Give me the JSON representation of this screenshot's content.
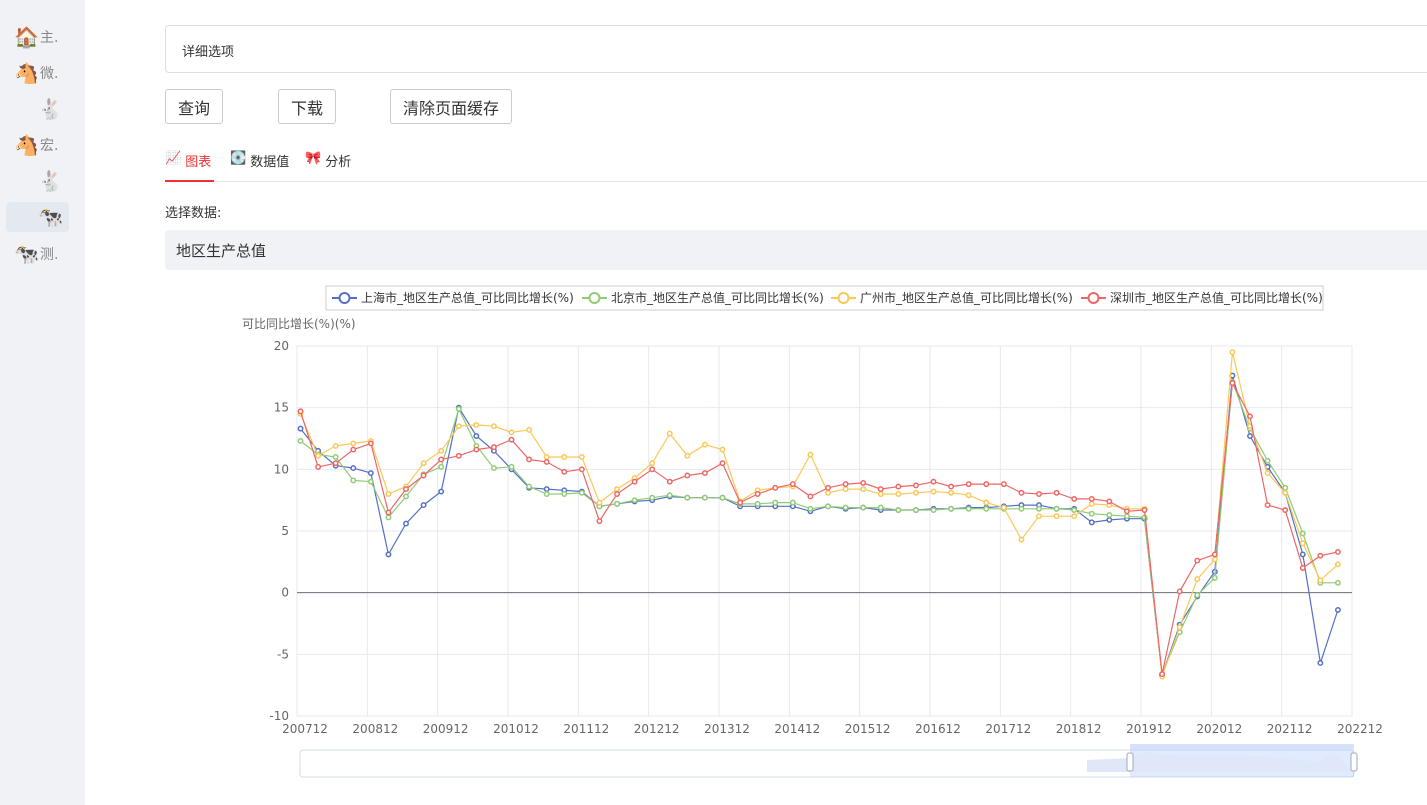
{
  "sidebar": {
    "items": [
      {
        "icon": "house-icon",
        "glyph": "🏠",
        "label": "主."
      },
      {
        "icon": "horse-icon",
        "glyph": "🐴",
        "label": "微."
      },
      {
        "icon": "rabbit-icon",
        "glyph": "🐇",
        "label": ""
      },
      {
        "icon": "horse-icon",
        "glyph": "🐴",
        "label": "宏."
      },
      {
        "icon": "rabbit-icon",
        "glyph": "🐇",
        "label": ""
      },
      {
        "icon": "cow-icon",
        "glyph": "🐄",
        "label": "",
        "active": true
      },
      {
        "icon": "cow-icon",
        "glyph": "🐄",
        "label": "测."
      }
    ]
  },
  "detail": {
    "placeholder": "详细选项"
  },
  "buttons": {
    "query": "查询",
    "download": "下载",
    "clear_cache": "清除页面缓存"
  },
  "tabs": [
    {
      "icon": "chart-icon",
      "glyph": "📈",
      "label": "图表",
      "active": true
    },
    {
      "icon": "disk-icon",
      "glyph": "💽",
      "label": "数据值"
    },
    {
      "icon": "ribbon-icon",
      "glyph": "🎀",
      "label": "分析"
    }
  ],
  "select_label": "选择数据:",
  "select_value": "地区生产总值",
  "chart_data": {
    "type": "line",
    "ylabel": "可比同比增长(%)(%)",
    "ylim": [
      -10,
      20
    ],
    "yticks": [
      "20",
      "15",
      "10",
      "5",
      "0",
      "-5",
      "-10"
    ],
    "xticks": [
      "200712",
      "200812",
      "200912",
      "201012",
      "201112",
      "201212",
      "201312",
      "201412",
      "201512",
      "201612",
      "201712",
      "201812",
      "201912",
      "202012",
      "202112",
      "202212"
    ],
    "legend_position": "top",
    "grid": true,
    "start_quarter": "2007Q4",
    "quarter_step": 1,
    "series": [
      {
        "name": "上海市_地区生产总值_可比同比增长(%)",
        "color": "#5470c6",
        "values": [
          13.3,
          11.5,
          10.3,
          10.1,
          9.7,
          3.1,
          5.6,
          7.1,
          8.2,
          15.0,
          12.7,
          11.5,
          10.0,
          8.5,
          8.4,
          8.3,
          8.2,
          7.0,
          7.2,
          7.4,
          7.5,
          7.8,
          7.7,
          7.7,
          7.7,
          7.0,
          7.0,
          7.0,
          7.0,
          6.6,
          7.0,
          6.8,
          6.9,
          6.7,
          6.7,
          6.7,
          6.8,
          6.8,
          6.9,
          6.9,
          7.0,
          7.1,
          7.1,
          6.8,
          6.8,
          5.7,
          5.9,
          6.0,
          6.0,
          -6.7,
          -2.6,
          -0.3,
          1.7,
          17.6,
          12.7,
          10.2,
          8.1,
          3.1,
          -5.7,
          -1.4
        ]
      },
      {
        "name": "北京市_地区生产总值_可比同比增长(%)",
        "color": "#91cc75",
        "values": [
          12.3,
          11.2,
          11.0,
          9.1,
          9.0,
          6.1,
          7.8,
          9.6,
          10.2,
          14.9,
          11.9,
          10.1,
          10.2,
          8.6,
          8.0,
          8.0,
          8.1,
          7.0,
          7.2,
          7.5,
          7.7,
          7.9,
          7.7,
          7.7,
          7.7,
          7.2,
          7.2,
          7.3,
          7.3,
          6.8,
          7.0,
          6.9,
          6.9,
          6.9,
          6.7,
          6.7,
          6.7,
          6.8,
          6.8,
          6.8,
          6.8,
          6.8,
          6.8,
          6.8,
          6.7,
          6.4,
          6.3,
          6.2,
          6.1,
          -6.6,
          -3.2,
          -0.2,
          1.2,
          17.1,
          13.3,
          10.7,
          8.5,
          4.8,
          0.8,
          0.8
        ]
      },
      {
        "name": "广州市_地区生产总值_可比同比增长(%)",
        "color": "#fac858",
        "values": [
          14.5,
          11.1,
          11.9,
          12.1,
          12.3,
          8.0,
          8.6,
          10.5,
          11.5,
          13.5,
          13.6,
          13.5,
          13.0,
          13.2,
          11.0,
          11.0,
          11.0,
          7.3,
          8.4,
          9.3,
          10.5,
          12.9,
          11.1,
          12.0,
          11.6,
          7.4,
          8.3,
          8.5,
          8.6,
          11.2,
          8.1,
          8.4,
          8.4,
          8.0,
          8.0,
          8.1,
          8.2,
          8.1,
          7.9,
          7.3,
          6.9,
          4.3,
          6.2,
          6.2,
          6.2,
          7.2,
          7.1,
          6.8,
          6.8,
          -6.8,
          -2.8,
          1.1,
          2.7,
          19.5,
          13.5,
          9.7,
          8.1,
          4.0,
          1.0,
          2.3
        ]
      },
      {
        "name": "深圳市_地区生产总值_可比同比增长(%)",
        "color": "#ee6666",
        "values": [
          14.7,
          10.2,
          10.5,
          11.6,
          12.1,
          6.5,
          8.4,
          9.5,
          10.8,
          11.1,
          11.6,
          11.8,
          12.4,
          10.8,
          10.6,
          9.8,
          10.0,
          5.8,
          8.0,
          9.0,
          10.0,
          9.0,
          9.5,
          9.7,
          10.5,
          7.3,
          8.0,
          8.5,
          8.8,
          7.8,
          8.5,
          8.8,
          8.9,
          8.4,
          8.6,
          8.7,
          9.0,
          8.6,
          8.8,
          8.8,
          8.8,
          8.1,
          8.0,
          8.1,
          7.6,
          7.6,
          7.4,
          6.6,
          6.7,
          -6.6,
          0.1,
          2.6,
          3.1,
          17.0,
          14.3,
          7.1,
          6.7,
          2.0,
          3.0,
          3.3
        ]
      }
    ]
  }
}
